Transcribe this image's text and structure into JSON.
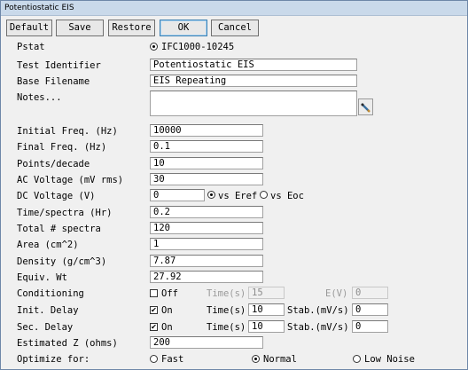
{
  "window": {
    "title": "Potentiostatic EIS"
  },
  "toolbar": {
    "default_label": "Default",
    "save_label": "Save",
    "restore_label": "Restore",
    "ok_label": "OK",
    "cancel_label": "Cancel"
  },
  "form": {
    "pstat": {
      "label": "Pstat",
      "value": "IFC1000-10245"
    },
    "test_identifier": {
      "label": "Test Identifier",
      "value": "Potentiostatic EIS"
    },
    "base_filename": {
      "label": "Base Filename",
      "value": "EIS Repeating"
    },
    "notes": {
      "label": "Notes...",
      "value": ""
    },
    "initial_freq": {
      "label": "Initial Freq. (Hz)",
      "value": "10000"
    },
    "final_freq": {
      "label": "Final Freq. (Hz)",
      "value": "0.1"
    },
    "points_decade": {
      "label": "Points/decade",
      "value": "10"
    },
    "ac_voltage": {
      "label": "AC Voltage (mV rms)",
      "value": "30"
    },
    "dc_voltage": {
      "label": "DC Voltage (V)",
      "value": "0",
      "vs_eref": "vs Eref",
      "vs_eoc": "vs Eoc",
      "selected": "vs Eref"
    },
    "time_spectra": {
      "label": "Time/spectra (Hr)",
      "value": "0.2"
    },
    "total_spectra": {
      "label": "Total # spectra",
      "value": "120"
    },
    "area": {
      "label": "Area (cm^2)",
      "value": "1"
    },
    "density": {
      "label": "Density (g/cm^3)",
      "value": "7.87"
    },
    "equiv_wt": {
      "label": "Equiv. Wt",
      "value": "27.92"
    },
    "conditioning": {
      "label": "Conditioning",
      "state": "Off",
      "checked": false,
      "time_label": "Time(s)",
      "time_value": "15",
      "e_label": "E(V)",
      "e_value": "0"
    },
    "init_delay": {
      "label": "Init. Delay",
      "state": "On",
      "checked": true,
      "time_label": "Time(s)",
      "time_value": "10",
      "stab_label": "Stab.(mV/s)",
      "stab_value": "0"
    },
    "sec_delay": {
      "label": "Sec. Delay",
      "state": "On",
      "checked": true,
      "time_label": "Time(s)",
      "time_value": "10",
      "stab_label": "Stab.(mV/s)",
      "stab_value": "0"
    },
    "estimated_z": {
      "label": "Estimated Z (ohms)",
      "value": "200"
    },
    "optimize": {
      "label": "Optimize for:",
      "options": [
        "Fast",
        "Normal",
        "Low Noise"
      ],
      "selected": "Normal"
    }
  },
  "colors": {
    "titlebar": "#c9d9ea",
    "dialog_bg": "#f0f0f0",
    "default_button_border": "#3c7fb1"
  },
  "icons": {
    "notes_button": "pencil-icon"
  }
}
